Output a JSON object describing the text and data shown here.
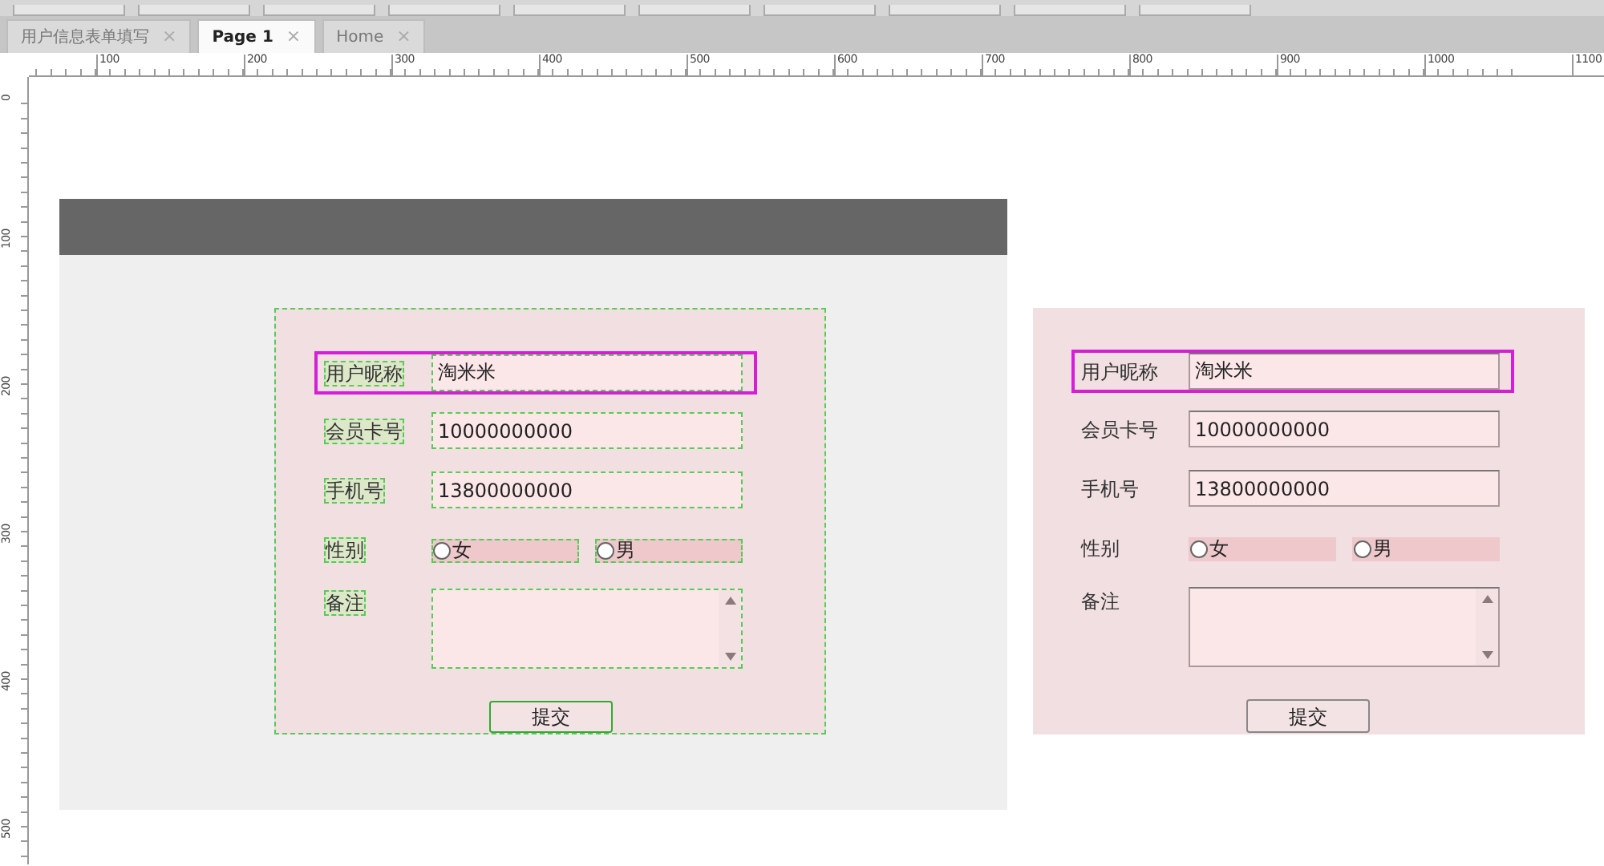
{
  "tabs": [
    {
      "label": "用户信息表单填写",
      "close": "×",
      "selected": false
    },
    {
      "label": "Page 1",
      "close": "×",
      "selected": true
    },
    {
      "label": "Home",
      "close": "×",
      "selected": false
    }
  ],
  "ruler": {
    "horizontal": [
      "100",
      "200",
      "300",
      "400",
      "500",
      "600",
      "700",
      "800",
      "900",
      "1000",
      "1100"
    ],
    "vertical": [
      "0",
      "100",
      "200",
      "300",
      "400",
      "500"
    ]
  },
  "forms": [
    {
      "outlined": true,
      "fields": [
        {
          "kind": "text",
          "label": "用户昵称",
          "value": "淘米米",
          "highlighted": true
        },
        {
          "kind": "text",
          "label": "会员卡号",
          "value": "10000000000",
          "highlighted": false
        },
        {
          "kind": "text",
          "label": "手机号",
          "value": "13800000000",
          "highlighted": false
        },
        {
          "kind": "radio",
          "label": "性别",
          "options": [
            {
              "label": "女",
              "selected": false
            },
            {
              "label": "男",
              "selected": false
            }
          ]
        },
        {
          "kind": "textarea",
          "label": "备注"
        }
      ],
      "submit": "提交"
    },
    {
      "outlined": false,
      "fields": [
        {
          "kind": "text",
          "label": "用户昵称",
          "value": "淘米米",
          "highlighted": true
        },
        {
          "kind": "text",
          "label": "会员卡号",
          "value": "10000000000",
          "highlighted": false
        },
        {
          "kind": "text",
          "label": "手机号",
          "value": "13800000000",
          "highlighted": false
        },
        {
          "kind": "radio",
          "label": "性别",
          "options": [
            {
              "label": "女",
              "selected": false
            },
            {
              "label": "男",
              "selected": false
            }
          ]
        },
        {
          "kind": "textarea",
          "label": "备注"
        }
      ],
      "submit": "提交"
    }
  ]
}
